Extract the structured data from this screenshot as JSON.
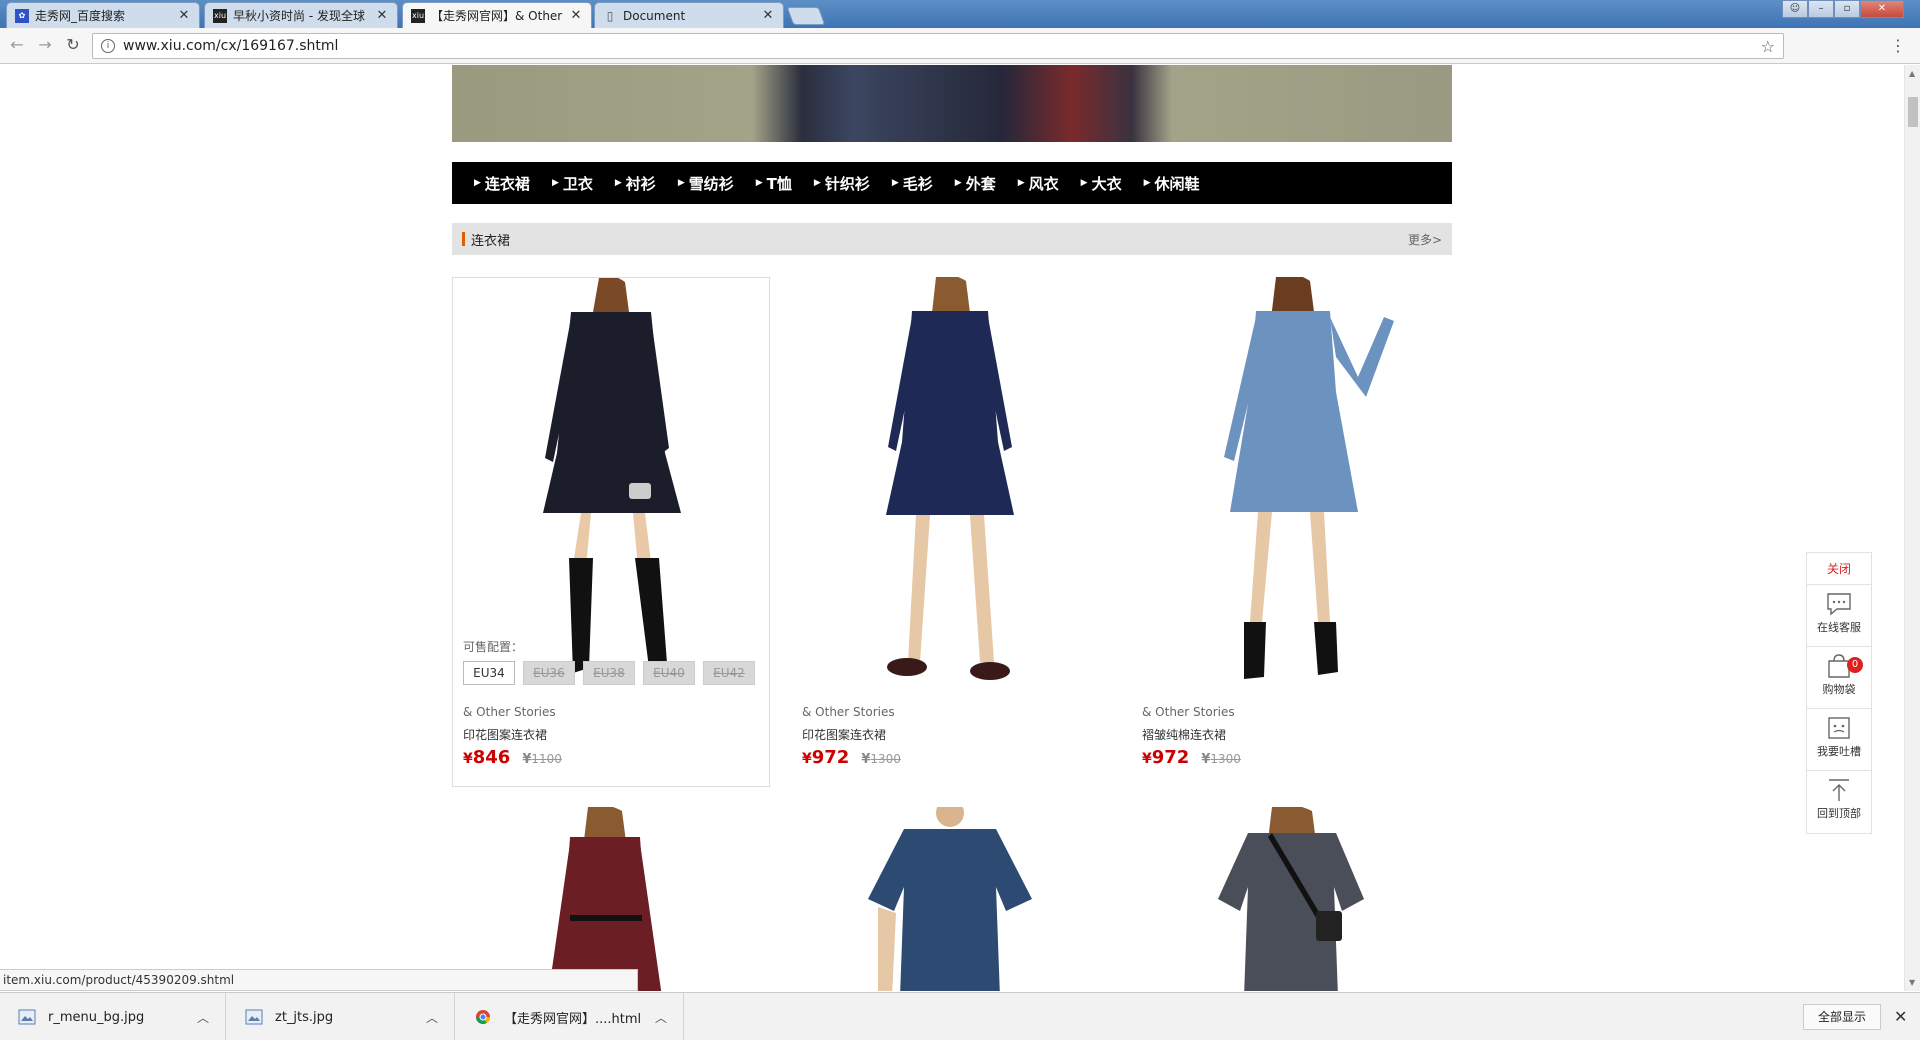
{
  "browser": {
    "tabs": [
      {
        "title": "走秀网_百度搜索",
        "icon": "baidu-paw-icon"
      },
      {
        "title": "早秋小资时尚 - 发现全球",
        "icon": "xiu-icon"
      },
      {
        "title": "【走秀网官网】& Other",
        "icon": "xiu-icon"
      },
      {
        "title": "Document",
        "icon": "document-icon"
      }
    ],
    "url": "www.xiu.com/cx/169167.shtml",
    "status_url": "item.xiu.com/product/45390209.shtml"
  },
  "page": {
    "categories": [
      "连衣裙",
      "卫衣",
      "衬衫",
      "雪纺衫",
      "T恤",
      "针织衫",
      "毛衫",
      "外套",
      "风衣",
      "大衣",
      "休闲鞋"
    ],
    "section_title": "连衣裙",
    "more_label": "更多>",
    "sizes_label": "可售配置：",
    "size_options": [
      "EU34",
      "EU36",
      "EU38",
      "EU40",
      "EU42"
    ],
    "products": [
      {
        "brand": "& Other Stories",
        "name": "印花图案连衣裙",
        "currency": "¥",
        "price": "846",
        "original_price": "1100",
        "dress_color": "#1b1e2a"
      },
      {
        "brand": "& Other Stories",
        "name": "印花图案连衣裙",
        "currency": "¥",
        "price": "972",
        "original_price": "1300",
        "dress_color": "#1e2a55"
      },
      {
        "brand": "& Other Stories",
        "name": "褶皱纯棉连衣裙",
        "currency": "¥",
        "price": "972",
        "original_price": "1300",
        "dress_color": "#6c93bf"
      }
    ],
    "row2_colors": [
      "#6b1f24",
      "#2d4a72",
      "#4a4e58"
    ]
  },
  "side_panel": {
    "close_label": "关闭",
    "items": [
      {
        "label": "在线客服",
        "icon": "chat-bubble-icon"
      },
      {
        "label": "购物袋",
        "icon": "shopping-bag-icon",
        "badge": "0"
      },
      {
        "label": "我要吐槽",
        "icon": "feedback-face-icon"
      },
      {
        "label": "回到顶部",
        "icon": "back-to-top-icon"
      }
    ]
  },
  "downloads": {
    "items": [
      {
        "name": "r_menu_bg.jpg",
        "icon": "image-file-icon"
      },
      {
        "name": "zt_jts.jpg",
        "icon": "image-file-icon"
      },
      {
        "name": "【走秀网官网】....html",
        "icon": "chrome-icon"
      }
    ],
    "show_all_label": "全部显示"
  },
  "colors": {
    "accent_price": "#cc0000",
    "nav_bg": "#000000",
    "section_marker": "#e35a00"
  }
}
